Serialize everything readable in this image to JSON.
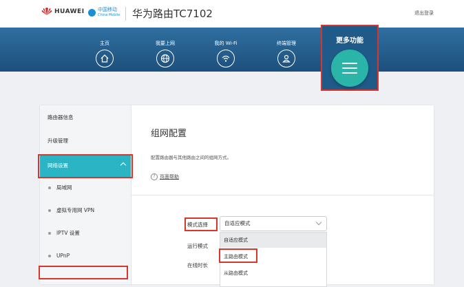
{
  "header": {
    "brand": "HUAWEI",
    "carrier_cn": "中国移动",
    "carrier_en": "China Mobile",
    "router_name": "华为路由TC7102",
    "logout": "退出登录"
  },
  "nav": {
    "items": [
      {
        "label": "主页",
        "icon": "home-icon"
      },
      {
        "label": "我要上网",
        "icon": "globe-icon"
      },
      {
        "label": "我的 Wi-Fi",
        "icon": "wifi-icon"
      },
      {
        "label": "终端管理",
        "icon": "user-icon"
      }
    ],
    "more": {
      "label": "更多功能",
      "icon": "menu-icon"
    }
  },
  "sidebar": {
    "items": [
      {
        "label": "路由器信息"
      },
      {
        "label": "升级管理"
      },
      {
        "label": "网络设置",
        "active": true
      }
    ],
    "sub_items": [
      {
        "label": "局域网"
      },
      {
        "label": "虚拟专用网 VPN"
      },
      {
        "label": "IPTV 设置"
      },
      {
        "label": "UPnP"
      }
    ]
  },
  "content": {
    "title": "组网配置",
    "description": "配置路由器与其他路由之间的组网方式。",
    "help": "页面帮助",
    "fields": {
      "mode_label": "模式选择",
      "run_mode_label": "运行模式",
      "online_label": "在线时长"
    },
    "select": {
      "value": "自适应模式",
      "options": [
        "自适应模式",
        "主路由模式",
        "从路由模式"
      ]
    }
  },
  "colors": {
    "nav_band": "#2f6fa0",
    "accent_teal": "#2bb5c4",
    "highlight_red": "#d9352b"
  }
}
